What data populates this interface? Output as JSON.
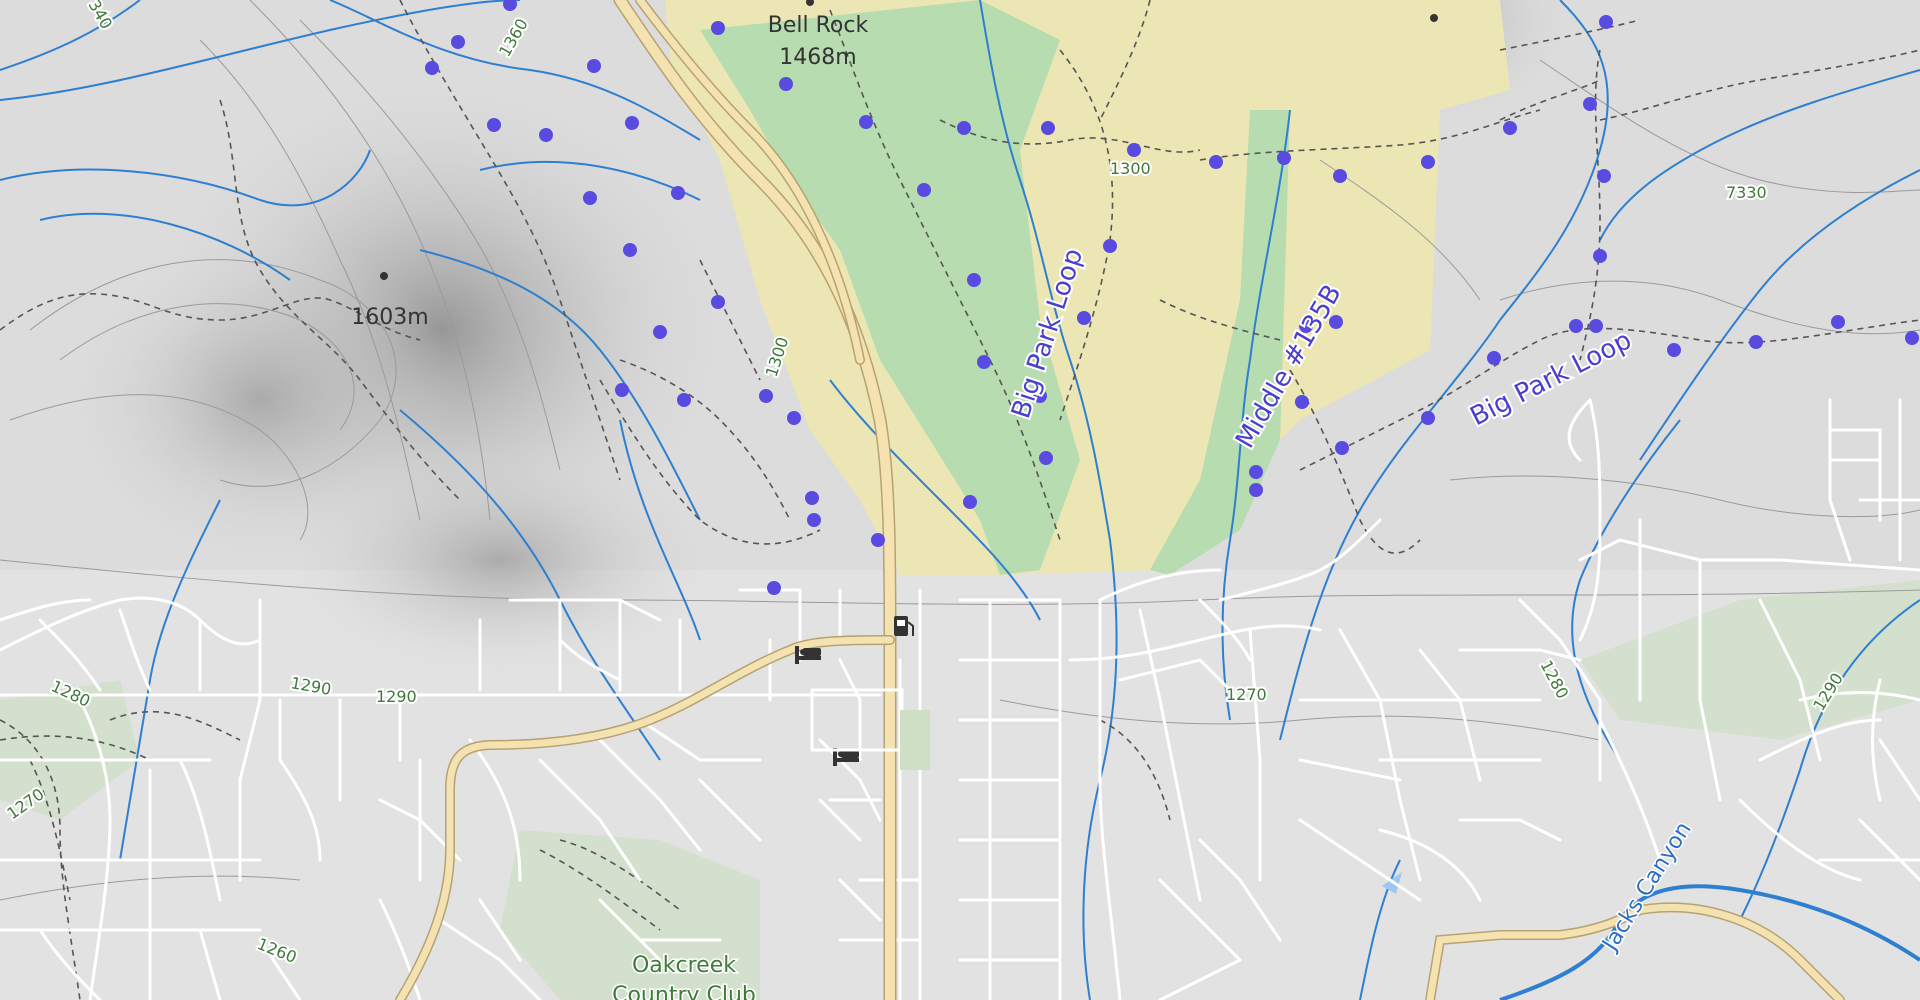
{
  "peaks": [
    {
      "name": "Bell Rock",
      "elevation": "1468m"
    },
    {
      "name": "",
      "elevation": "1603m"
    }
  ],
  "trails": [
    {
      "name": "Big Park Loop"
    },
    {
      "name": "Middle #135B"
    },
    {
      "name": "Big Park Loop"
    }
  ],
  "contours": [
    "1360",
    "1300",
    "1300",
    "7330",
    "1280",
    "1290",
    "1290",
    "1270",
    "1280",
    "1290",
    "1270",
    "1260",
    "340"
  ],
  "places": [
    "Oakcreek",
    "Country Club"
  ],
  "water": [
    "Jacks Canyon"
  ],
  "colors": {
    "terrain": "#dcdcdc",
    "forest": "#b6dcb0",
    "scrub": "#ece6b4",
    "road_major": "#f4e3b0",
    "road_minor": "#ffffff",
    "stream": "#2f7fd0",
    "trail_marker": "#5a4be0",
    "contour": "#9a9a9a"
  },
  "icons": [
    "fuel-station-icon",
    "lodging-icon",
    "lodging-icon"
  ]
}
